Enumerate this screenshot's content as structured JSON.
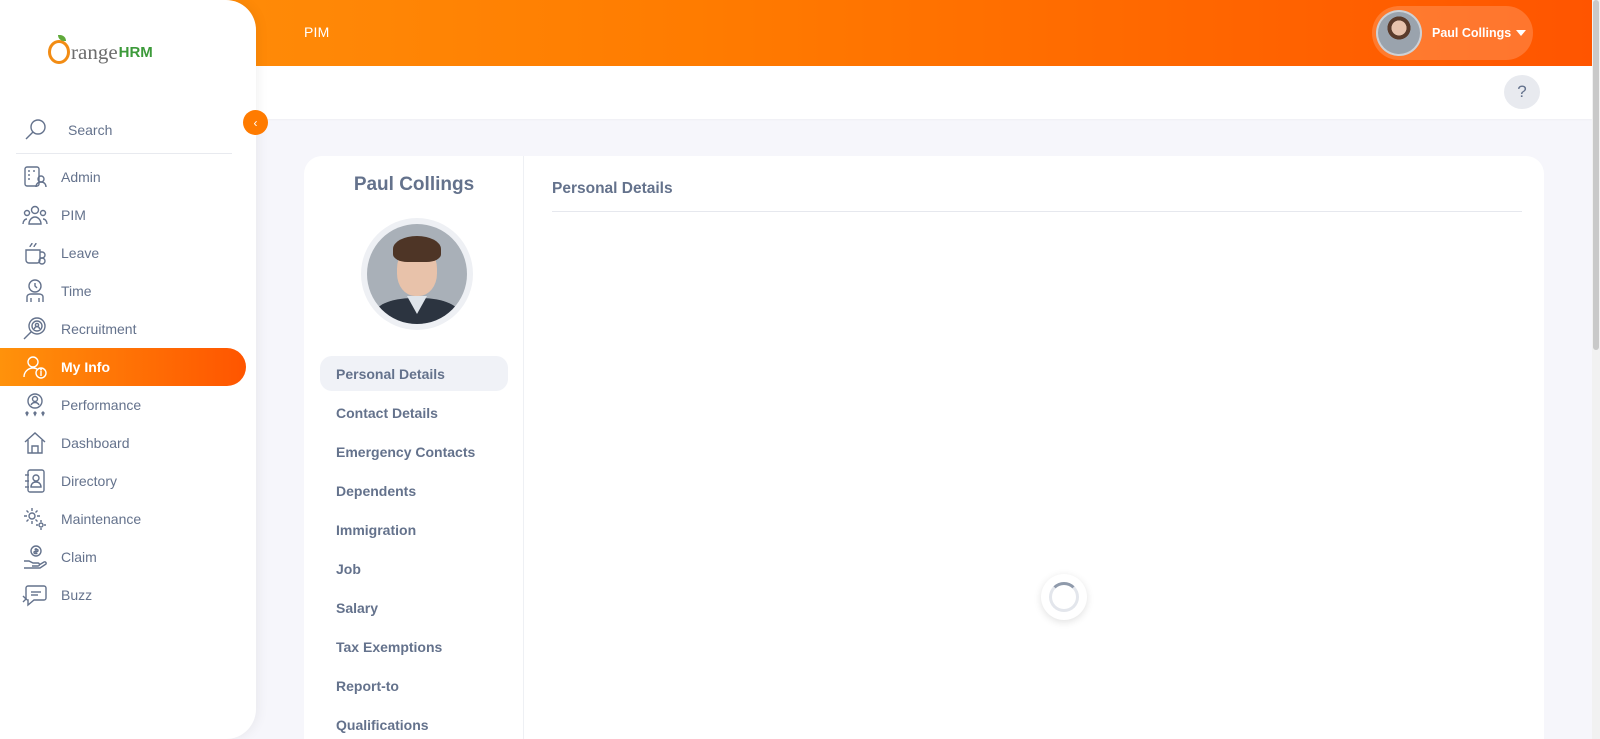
{
  "app": {
    "brand_word": "range",
    "brand_suffix": "HRM"
  },
  "topbar": {
    "module_title": "PIM",
    "user_name": "Paul Collings"
  },
  "subheader": {
    "help_label": "?"
  },
  "sidebar": {
    "search_placeholder": "Search",
    "items": [
      {
        "label": "Admin",
        "icon": "admin-icon",
        "active": false
      },
      {
        "label": "PIM",
        "icon": "pim-icon",
        "active": false
      },
      {
        "label": "Leave",
        "icon": "leave-icon",
        "active": false
      },
      {
        "label": "Time",
        "icon": "time-icon",
        "active": false
      },
      {
        "label": "Recruitment",
        "icon": "recruitment-icon",
        "active": false
      },
      {
        "label": "My Info",
        "icon": "my-info-icon",
        "active": true
      },
      {
        "label": "Performance",
        "icon": "performance-icon",
        "active": false
      },
      {
        "label": "Dashboard",
        "icon": "dashboard-icon",
        "active": false
      },
      {
        "label": "Directory",
        "icon": "directory-icon",
        "active": false
      },
      {
        "label": "Maintenance",
        "icon": "maintenance-icon",
        "active": false
      },
      {
        "label": "Claim",
        "icon": "claim-icon",
        "active": false
      },
      {
        "label": "Buzz",
        "icon": "buzz-icon",
        "active": false
      }
    ]
  },
  "profile": {
    "name": "Paul Collings",
    "tabs": [
      {
        "label": "Personal Details",
        "active": true
      },
      {
        "label": "Contact Details",
        "active": false
      },
      {
        "label": "Emergency Contacts",
        "active": false
      },
      {
        "label": "Dependents",
        "active": false
      },
      {
        "label": "Immigration",
        "active": false
      },
      {
        "label": "Job",
        "active": false
      },
      {
        "label": "Salary",
        "active": false
      },
      {
        "label": "Tax Exemptions",
        "active": false
      },
      {
        "label": "Report-to",
        "active": false
      },
      {
        "label": "Qualifications",
        "active": false
      }
    ]
  },
  "details": {
    "section_title": "Personal Details",
    "loading": true
  },
  "colors": {
    "accent": "#ff7b00",
    "text": "#64728c"
  }
}
